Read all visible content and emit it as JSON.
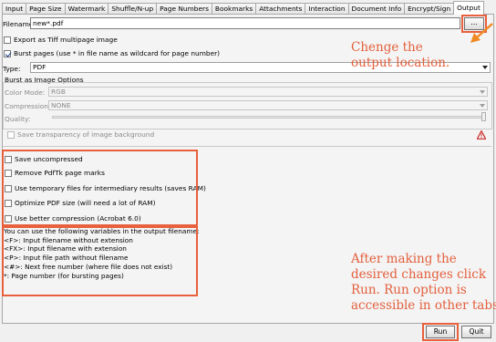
{
  "tabs": [
    {
      "label": "Input",
      "active": false
    },
    {
      "label": "Page Size",
      "active": false
    },
    {
      "label": "Watermark",
      "active": false
    },
    {
      "label": "Shuffle/N-up",
      "active": false
    },
    {
      "label": "Page Numbers",
      "active": false
    },
    {
      "label": "Bookmarks",
      "active": false
    },
    {
      "label": "Attachments",
      "active": false
    },
    {
      "label": "Interaction",
      "active": false
    },
    {
      "label": "Document Info",
      "active": false
    },
    {
      "label": "Encrypt/Sign",
      "active": false
    },
    {
      "label": "Output",
      "active": true
    }
  ],
  "filename": {
    "label": "Filename:",
    "value": "new*.pdf",
    "browse_label": "..."
  },
  "export_tiff": {
    "label": "Export as Tiff multipage image",
    "checked": false
  },
  "burst_pages": {
    "label": "Burst pages (use * in file name as wildcard for page number)",
    "checked": true
  },
  "type": {
    "label": "Type:",
    "value": "PDF"
  },
  "burst_image": {
    "title": "Burst as Image Options",
    "color_mode": {
      "label": "Color Mode:",
      "value": "RGB"
    },
    "compression": {
      "label": "Compression:",
      "value": "NONE"
    },
    "quality": {
      "label": "Quality:",
      "value": 1.0
    },
    "transparency": {
      "label": "Save transparency of image background",
      "checked": false
    }
  },
  "options": [
    {
      "label": "Save uncompressed",
      "checked": false
    },
    {
      "label": "Remove PdfTk page marks",
      "checked": false
    },
    {
      "label": "Use temporary files for intermediary results (saves RAM)",
      "checked": false
    },
    {
      "label": "Optimize PDF size (will need a lot of RAM)",
      "checked": false
    },
    {
      "label": "Use better compression (Acrobat 6.0)",
      "checked": false
    }
  ],
  "variables": {
    "intro": "You can use the following variables in the output filename:",
    "lines": [
      "<F>: Input filename without extension",
      "<FX>: Input filename with extension",
      "<P>: Input file path without filename",
      "<#>: Next free number (where file does not exist)",
      "*: Page number (for bursting pages)"
    ]
  },
  "annotations": {
    "output_location": "Chenge the output location.",
    "run_note_lines": [
      "After making the",
      "desired changes click",
      "Run. Run option is",
      "accessible in other tabs."
    ]
  },
  "buttons": {
    "run": "Run",
    "quit": "Quit"
  },
  "colors": {
    "annotation": "#e35f3c",
    "highlight_box": "#e8603c",
    "warning_icon": "#cc2b2b"
  }
}
